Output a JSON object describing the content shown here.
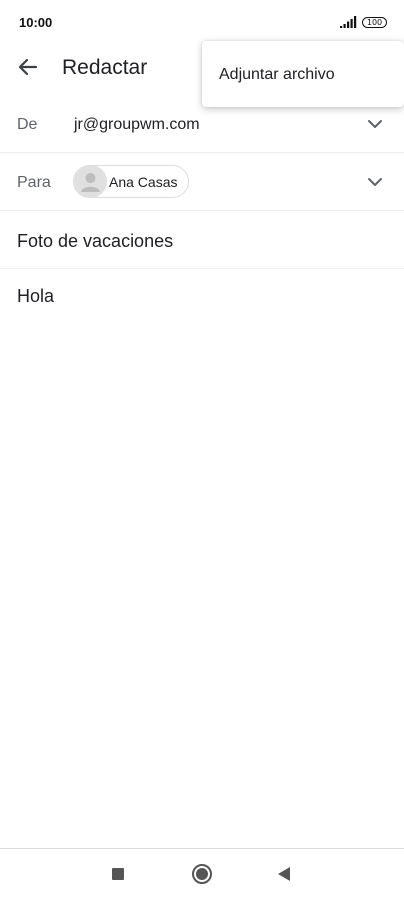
{
  "status_bar": {
    "time": "10:00",
    "battery": "100"
  },
  "app_bar": {
    "title": "Redactar"
  },
  "menu": {
    "items": [
      {
        "label": "Adjuntar archivo"
      }
    ]
  },
  "compose": {
    "from": {
      "label": "De",
      "value": "jr@groupwm.com"
    },
    "to": {
      "label": "Para",
      "recipient": "Ana Casas"
    },
    "subject": "Foto de vacaciones",
    "body": "Hola"
  },
  "icons": {
    "back": "arrow-left-icon",
    "dropdown": "chevron-down-icon",
    "avatar": "person-icon",
    "signal": "signal-icon",
    "nav_recent": "square-icon",
    "nav_home": "circle-icon",
    "nav_back": "triangle-left-icon"
  },
  "colors": {
    "text": "#202124",
    "label": "#5f6368",
    "divider": "#eeeeee",
    "avatar_bg": "#e0e0e0"
  }
}
